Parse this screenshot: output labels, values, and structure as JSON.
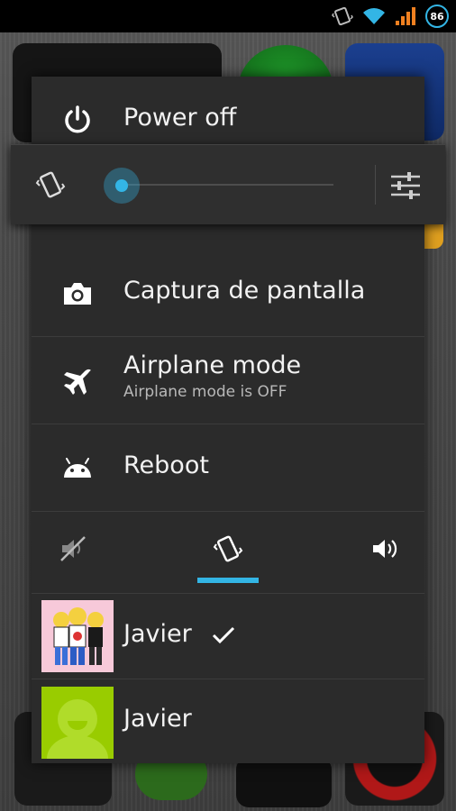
{
  "status_bar": {
    "icons": [
      "vibrate-icon",
      "wifi-icon",
      "signal-icon"
    ],
    "battery_level": "86",
    "accent_color": "#33b5e5"
  },
  "power_menu": {
    "power_off": {
      "label": "Power off",
      "icon": "power-icon"
    },
    "volume": {
      "ringer_mode_icon": "vibrate-icon",
      "settings_icon": "sliders-icon",
      "level_fraction": 0.0
    },
    "screenshot": {
      "label": "Captura de pantalla",
      "icon": "camera-icon"
    },
    "airplane": {
      "label": "Airplane mode",
      "status": "Airplane mode is OFF",
      "icon": "airplane-icon"
    },
    "reboot": {
      "label": "Reboot",
      "icon": "android-icon"
    },
    "sound_modes": {
      "options": [
        "silent-icon",
        "vibrate-icon",
        "sound-on-icon"
      ],
      "selected": "vibrate-icon"
    },
    "users": [
      {
        "name": "Javier",
        "selected": true,
        "avatar": "simpsons-photo"
      },
      {
        "name": "Javier",
        "selected": false,
        "avatar": "default-user-avatar"
      }
    ]
  }
}
